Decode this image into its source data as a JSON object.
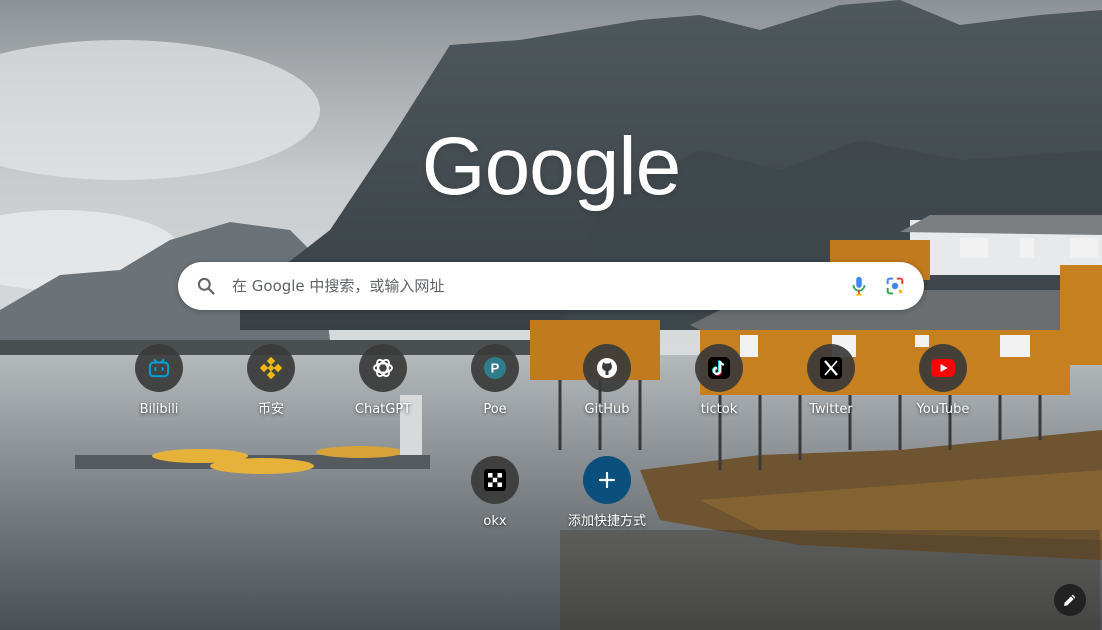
{
  "logo": {
    "text": "Google"
  },
  "search": {
    "placeholder": "在 Google 中搜索，或输入网址",
    "value": ""
  },
  "shortcuts": [
    {
      "label": "Bilibili",
      "icon": "bilibili-icon",
      "color": "#00a1d6"
    },
    {
      "label": "币安",
      "icon": "binance-icon",
      "color": "#f0b90b"
    },
    {
      "label": "ChatGPT",
      "icon": "chatgpt-icon",
      "color": "#ffffff"
    },
    {
      "label": "Poe",
      "icon": "poe-icon",
      "color": "#2f7d8c"
    },
    {
      "label": "GitHub",
      "icon": "github-icon",
      "color": "#ffffff"
    },
    {
      "label": "tictok",
      "icon": "tiktok-icon",
      "color": "#000000"
    },
    {
      "label": "Twitter",
      "icon": "x-icon",
      "color": "#000000"
    },
    {
      "label": "YouTube",
      "icon": "youtube-icon",
      "color": "#ff0000"
    },
    {
      "label": "okx",
      "icon": "okx-icon",
      "color": "#000000"
    },
    {
      "label": "添加快捷方式",
      "icon": "plus-icon",
      "color": "#0b4f7c"
    }
  ]
}
